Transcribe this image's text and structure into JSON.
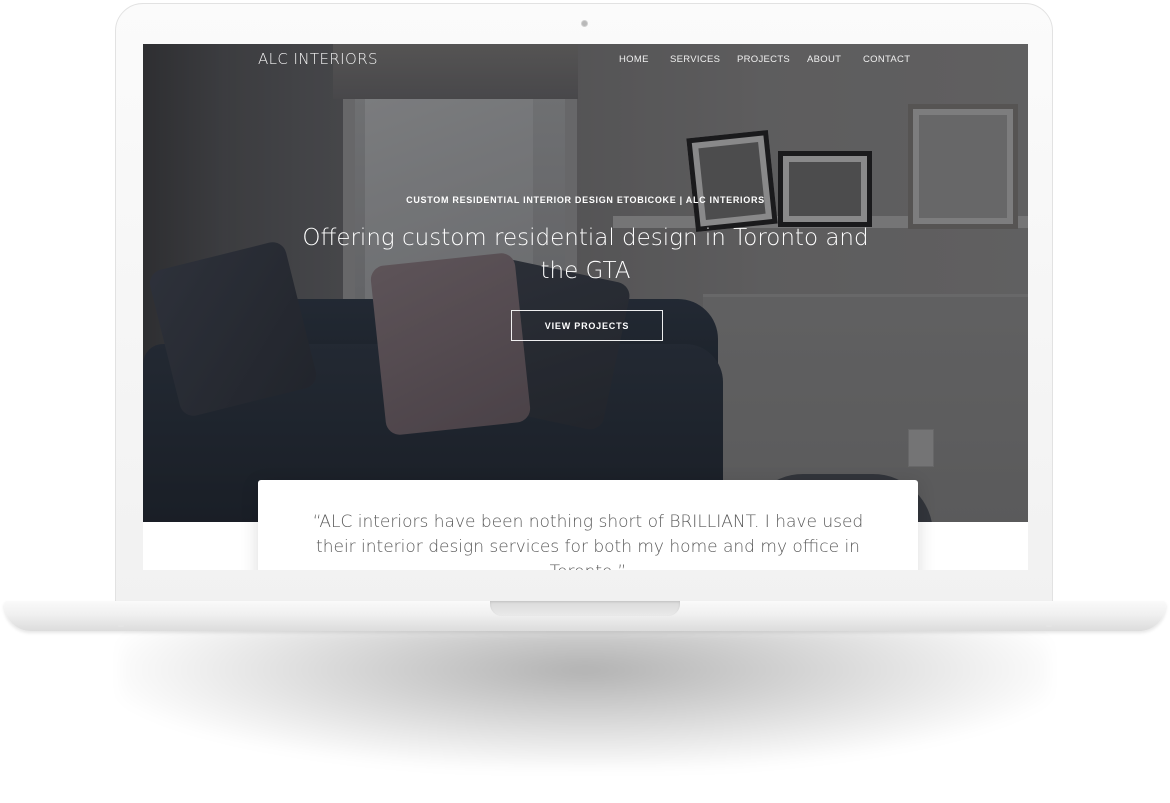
{
  "site": {
    "logo": "ALC INTERIORS"
  },
  "nav": {
    "items": [
      {
        "label": "HOME"
      },
      {
        "label": "SERVICES"
      },
      {
        "label": "PROJECTS"
      },
      {
        "label": "ABOUT"
      },
      {
        "label": "CONTACT"
      }
    ]
  },
  "hero": {
    "eyebrow": "CUSTOM RESIDENTIAL INTERIOR DESIGN ETOBICOKE | ALC INTERIORS",
    "headline": "Offering custom residential design in Toronto and the GTA",
    "cta_label": "VIEW PROJECTS"
  },
  "testimonial": {
    "quote": "“ALC interiors have been nothing short of BRILLIANT. I have used their interior design services for both my home and my office in Toronto.”"
  },
  "colors": {
    "hero_text": "#ffffff",
    "quote_text": "#595959",
    "device_frame": "#f4f4f4"
  }
}
